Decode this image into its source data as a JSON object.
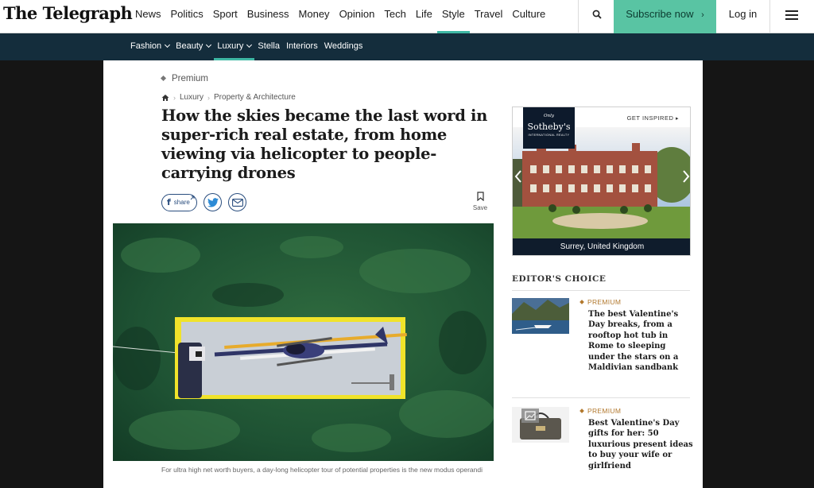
{
  "brand": {
    "logo": "The Telegraph"
  },
  "main_nav": [
    {
      "label": "News"
    },
    {
      "label": "Politics"
    },
    {
      "label": "Sport"
    },
    {
      "label": "Business"
    },
    {
      "label": "Money"
    },
    {
      "label": "Opinion"
    },
    {
      "label": "Tech"
    },
    {
      "label": "Life"
    },
    {
      "label": "Style",
      "active": true
    },
    {
      "label": "Travel"
    },
    {
      "label": "Culture"
    }
  ],
  "header_actions": {
    "search_icon": "search-icon",
    "subscribe": "Subscribe now",
    "login": "Log in",
    "menu_icon": "menu-icon"
  },
  "sub_nav": [
    {
      "label": "Fashion",
      "dropdown": true
    },
    {
      "label": "Beauty",
      "dropdown": true
    },
    {
      "label": "Luxury",
      "dropdown": true,
      "active": true
    },
    {
      "label": "Stella"
    },
    {
      "label": "Interiors"
    },
    {
      "label": "Weddings"
    }
  ],
  "article": {
    "premium_label": "Premium",
    "breadcrumb": [
      "Luxury",
      "Property & Architecture"
    ],
    "headline": "How the skies became the last word in super-rich real estate, from home viewing via helicopter to people-carrying drones",
    "share_label": "share",
    "save_label": "Save",
    "caption": "For ultra high net worth buyers, a day-long helicopter tour of potential properties is the new modus operandi"
  },
  "ad": {
    "only": "Only",
    "brand": "Sotheby's",
    "brand_sub": "INTERNATIONAL REALTY",
    "cta": "GET INSPIRED",
    "location": "Surrey, United Kingdom"
  },
  "editors_choice": {
    "title": "EDITOR'S CHOICE",
    "items": [
      {
        "kicker": "PREMIUM",
        "headline": "The best Valentine's Day breaks, from a rooftop hot tub in Rome to sleeping under the stars on a Maldivian sandbank"
      },
      {
        "kicker": "PREMIUM",
        "headline": "Best Valentine's Day gifts for her: 50 luxurious present ideas to buy your wife or girlfriend"
      }
    ]
  },
  "colors": {
    "accent": "#3fb8a4",
    "subscribe": "#59c4a3",
    "subnav": "#142d3c",
    "premium": "#b2782d"
  }
}
